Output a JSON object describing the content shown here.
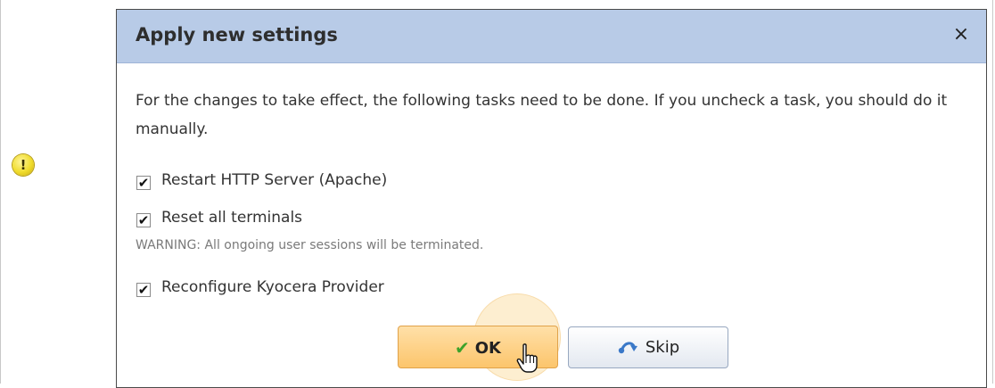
{
  "dialog": {
    "title": "Apply new settings",
    "close_glyph": "×",
    "message": "For the changes to take effect, the following tasks need to be done. If you uncheck a task, you should do it manually.",
    "tasks": [
      {
        "label": "Restart HTTP Server (Apache)",
        "checked": true
      },
      {
        "label": "Reset all terminals",
        "checked": true
      },
      {
        "label": "Reconfigure Kyocera Provider",
        "checked": true
      }
    ],
    "warning": "WARNING: All ongoing user sessions will be terminated.",
    "ok_label": "OK",
    "skip_label": "Skip"
  },
  "icons": {
    "warning": "warning-icon",
    "close": "close-icon",
    "checkbox_check": "check-icon",
    "ok": "green-check-icon",
    "skip": "skip-arrow-icon",
    "cursor": "hand-cursor-icon"
  },
  "colors": {
    "titlebar": "#b8cbe7",
    "ok_button": "#fcc56c",
    "skip_button": "#e3e8f0",
    "warning_text": "#7a7a7a",
    "warning_dot": "#f0dc2c"
  }
}
